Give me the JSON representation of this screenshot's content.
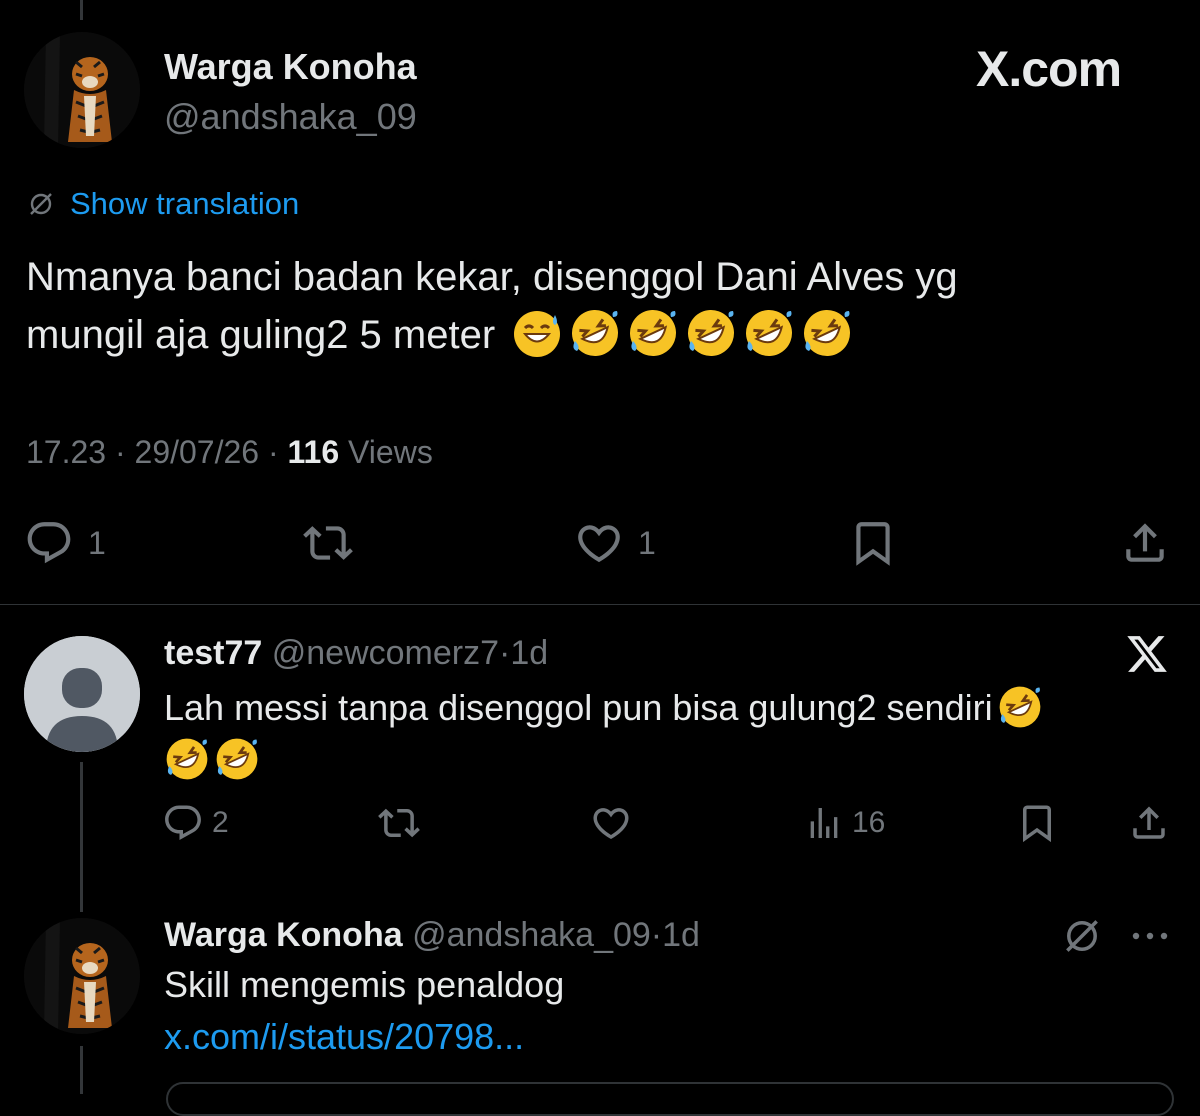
{
  "watermark": "X.com",
  "main_tweet": {
    "display_name": "Warga Konoha",
    "handle": "@andshaka_09",
    "translation_label": "Show translation",
    "text_line1": "Nmanya banci badan kekar, disenggol Dani Alves yg",
    "text_line2": "mungil aja guling2 5 meter",
    "emojis": [
      "sweat-smile",
      "rofl",
      "rofl",
      "rofl",
      "rofl",
      "rofl"
    ],
    "time": "17.23",
    "separator": "·",
    "date": "29/07/26",
    "views_count": "116",
    "views_label": "Views",
    "reply_count": "1",
    "like_count": "1"
  },
  "reply1": {
    "display_name": "test77",
    "handle": "@newcomerz7",
    "separator": "·",
    "time_ago": "1d",
    "text": "Lah messi tanpa disenggol pun bisa gulung2 sendiri",
    "emojis": [
      "rofl",
      "rofl",
      "rofl"
    ],
    "reply_count": "2",
    "views_count": "16"
  },
  "reply2": {
    "display_name": "Warga Konoha",
    "handle": "@andshaka_09",
    "separator": "·",
    "time_ago": "1d",
    "text": "Skill mengemis penaldog",
    "link": "x.com/i/status/20798..."
  },
  "colors": {
    "background": "#000000",
    "text": "#e7e9ea",
    "muted": "#71767b",
    "link": "#1d9bf0"
  }
}
